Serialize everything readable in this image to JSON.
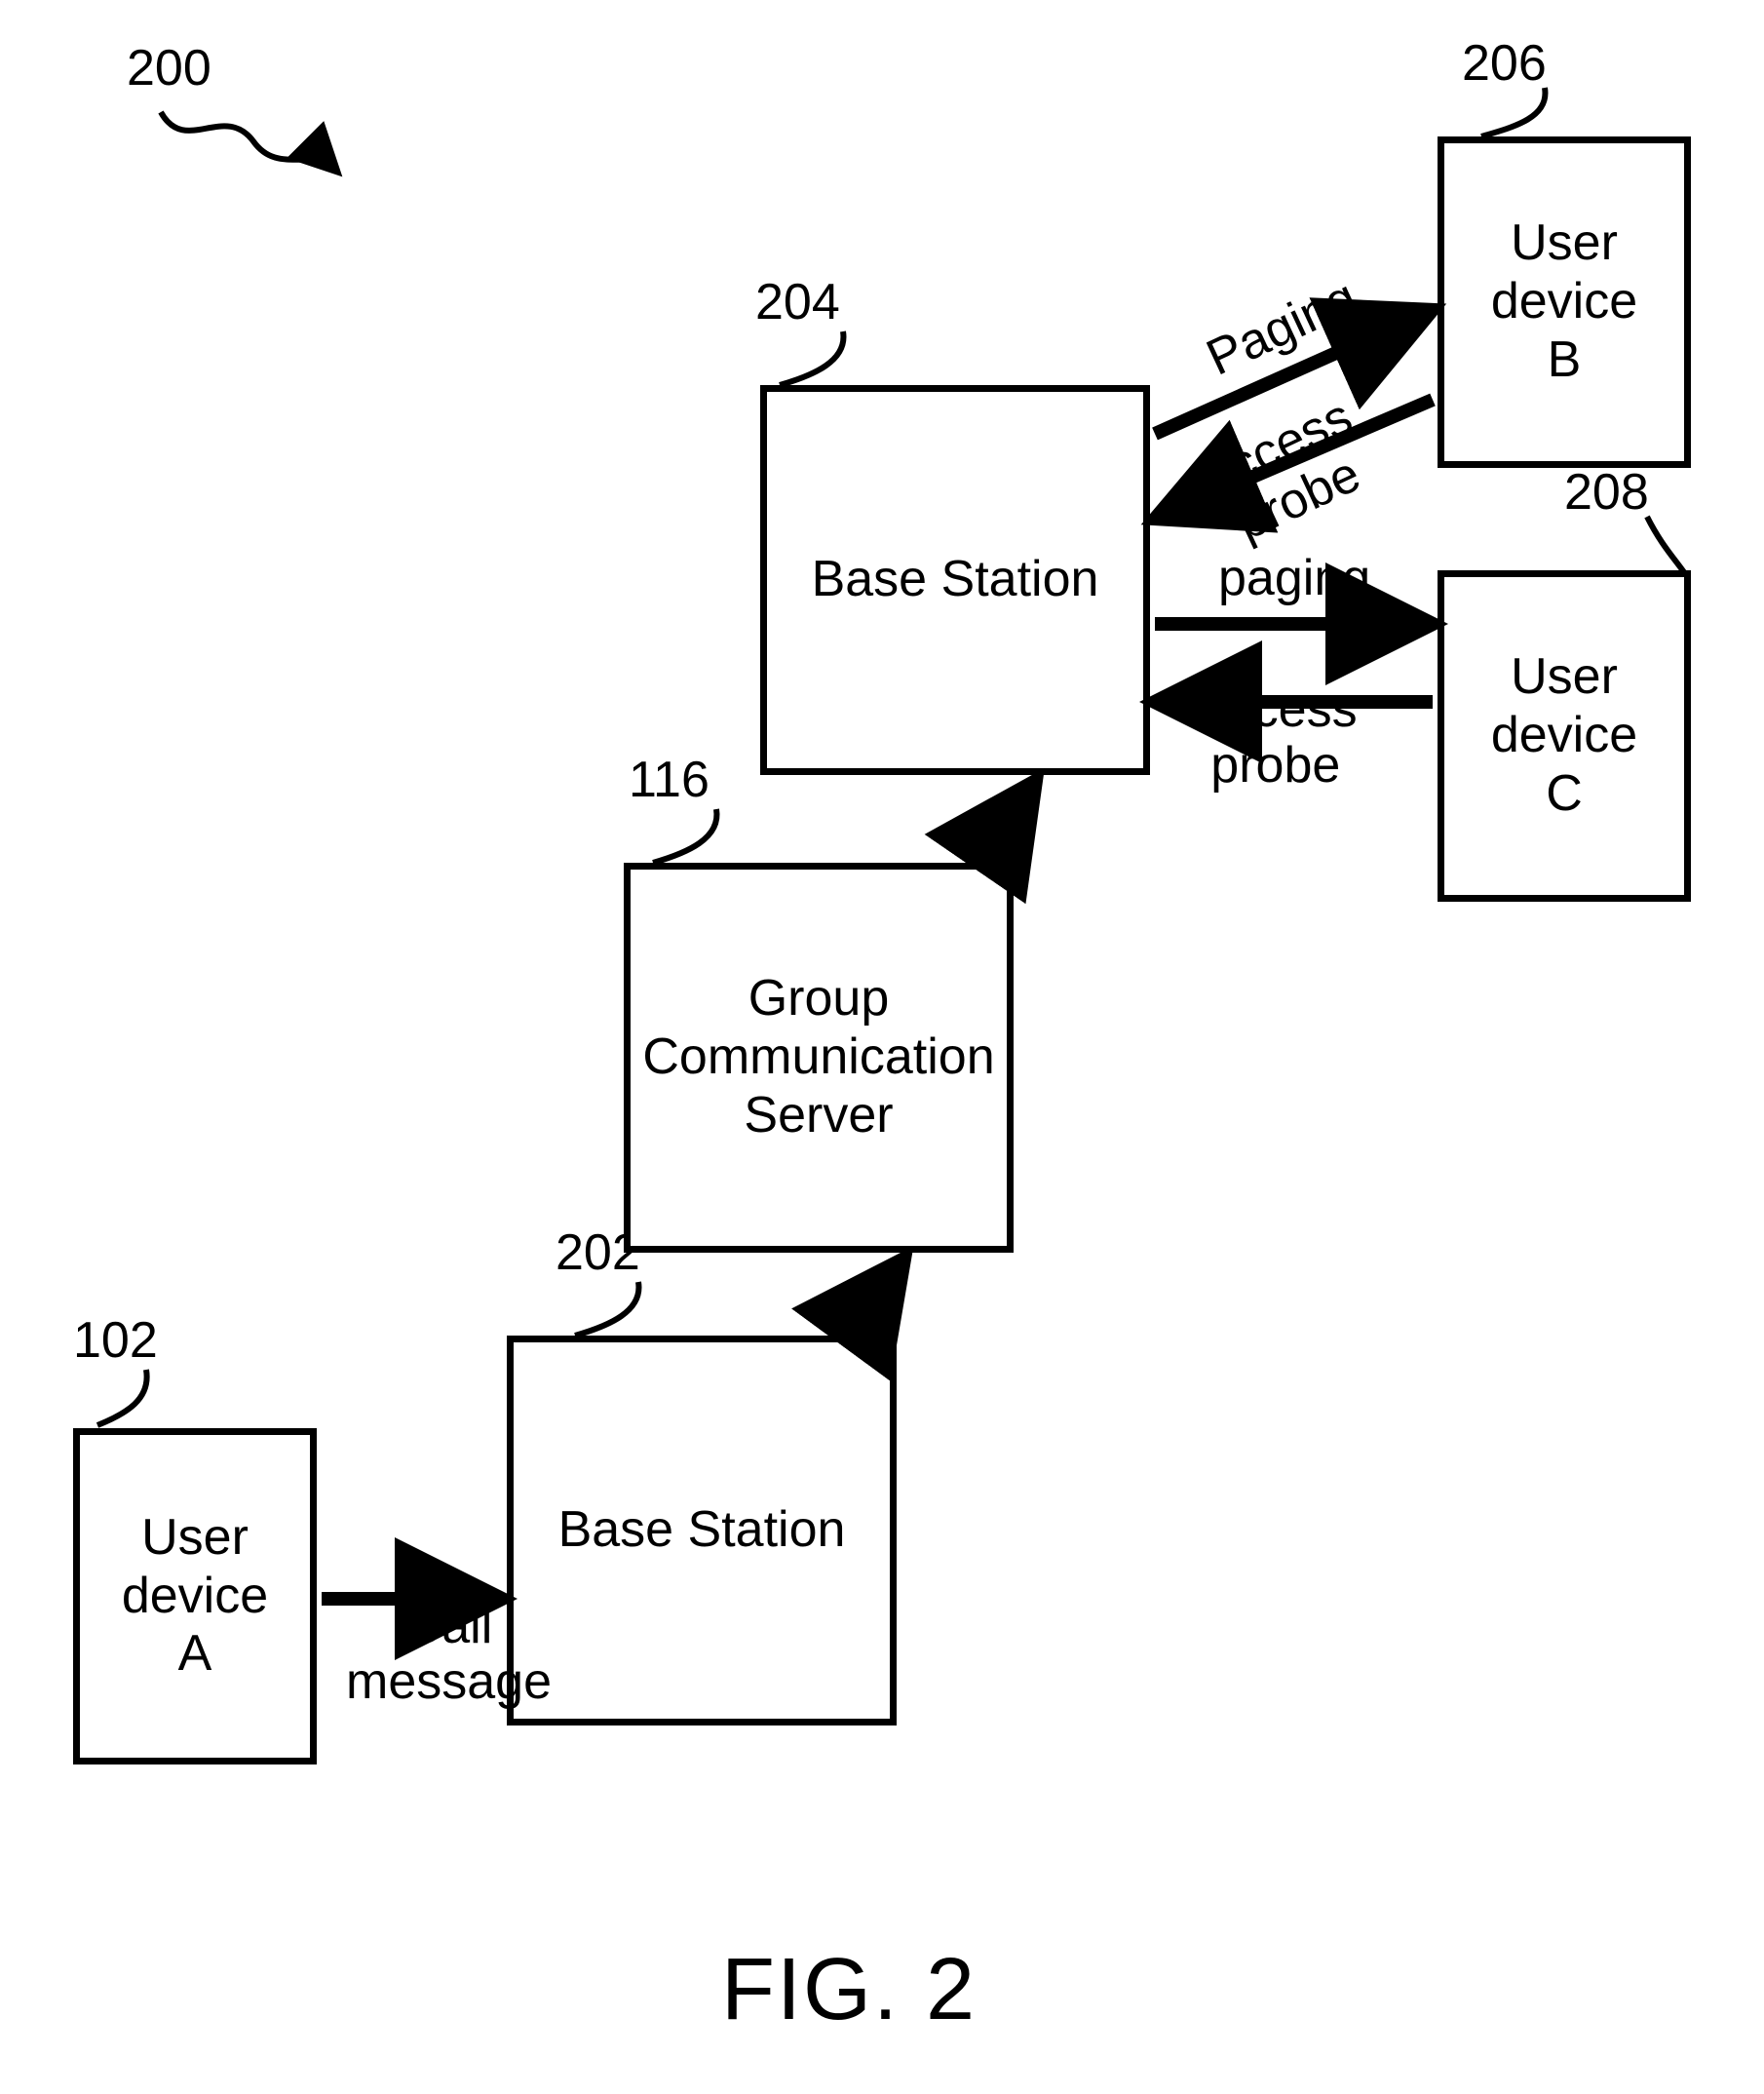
{
  "figure": {
    "number_ref": "200",
    "caption": "FIG. 2"
  },
  "nodes": {
    "device_a": {
      "ref": "102",
      "label": "User\ndevice\nA"
    },
    "bs1": {
      "ref": "202",
      "label": "Base Station"
    },
    "gcs": {
      "ref": "116",
      "label": "Group\nCommunication\nServer"
    },
    "bs2": {
      "ref": "204",
      "label": "Base Station"
    },
    "device_b": {
      "ref": "206",
      "label": "User\ndevice\nB"
    },
    "device_c": {
      "ref": "208",
      "label": "User\ndevice\nC"
    }
  },
  "edges": {
    "a_to_bs1": "Call\nmessage",
    "bs2_to_b": "Paging",
    "b_to_bs2": "Access\nprobe",
    "bs2_to_c": "paging",
    "c_to_bs2": "Access\nprobe"
  }
}
